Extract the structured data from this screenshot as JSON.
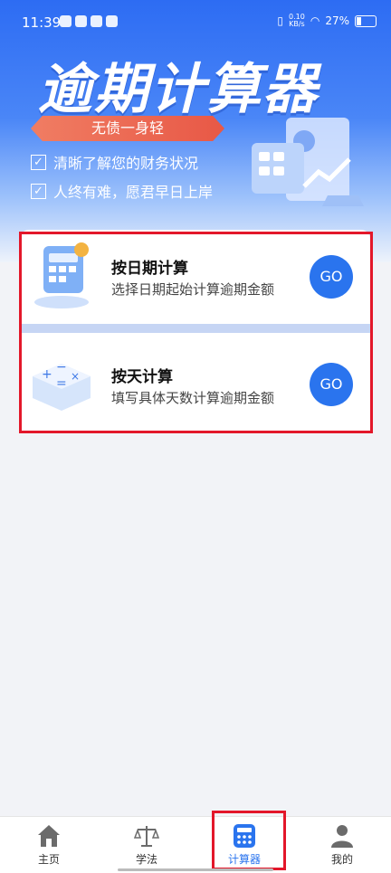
{
  "status_bar": {
    "time": "11:39",
    "net_speed": "0.10\nKB/s",
    "battery": "27%"
  },
  "hero": {
    "title": "逾期计算器",
    "ribbon": "无债一身轻",
    "bullets": [
      "清晰了解您的财务状况",
      "人终有难，愿君早日上岸"
    ]
  },
  "cards": [
    {
      "name": "按日期计算",
      "desc": "选择日期起始计算逾期金额",
      "go_label": "GO"
    },
    {
      "name": "按天计算",
      "desc": "填写具体天数计算逾期金额",
      "go_label": "GO"
    }
  ],
  "nav": [
    {
      "label": "主页",
      "icon": "home-icon"
    },
    {
      "label": "学法",
      "icon": "scales-icon"
    },
    {
      "label": "计算器",
      "icon": "calculator-icon",
      "active": true
    },
    {
      "label": "我的",
      "icon": "user-icon"
    }
  ],
  "colors": {
    "accent": "#2a74ee",
    "highlight_box": "#e3172a",
    "hero_top": "#2d6cf3"
  }
}
